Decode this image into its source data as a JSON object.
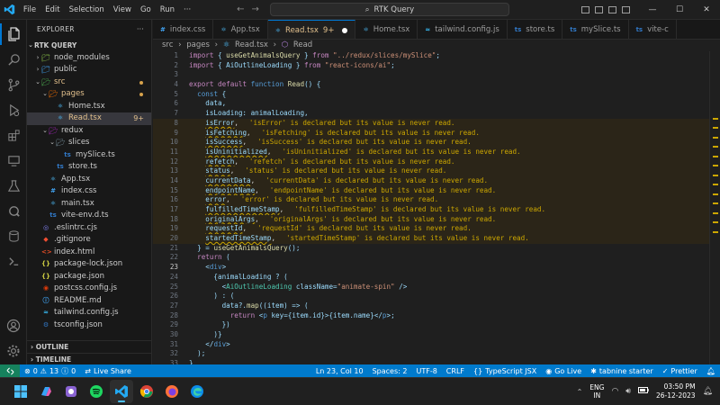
{
  "window": {
    "menu": [
      "File",
      "Edit",
      "Selection",
      "View",
      "Go",
      "Run",
      "···"
    ],
    "search_text": "RTK Query"
  },
  "activity_bar": [
    "files-icon",
    "search-icon",
    "source-control-icon",
    "run-debug-icon",
    "extensions-icon",
    "remote-explorer-icon",
    "testing-icon",
    "docker-icon",
    "database-icon",
    "terminal-icon",
    "accounts-icon",
    "manage-gear-icon"
  ],
  "explorer": {
    "header": "EXPLORER",
    "root": "RTK QUERY",
    "items": [
      {
        "label": "node_modules",
        "depth": 1,
        "type": "folder",
        "open": false,
        "color": "#cccccc"
      },
      {
        "label": "public",
        "depth": 1,
        "type": "folder",
        "open": false,
        "color": "#cccccc"
      },
      {
        "label": "src",
        "depth": 1,
        "type": "folder",
        "open": true,
        "color": "#e2c08d",
        "dot": true
      },
      {
        "label": "pages",
        "depth": 2,
        "type": "folder",
        "open": true,
        "color": "#e2c08d",
        "dot": true
      },
      {
        "label": "Home.tsx",
        "depth": 3,
        "type": "file",
        "icon": "react",
        "color": "#cccccc"
      },
      {
        "label": "Read.tsx",
        "depth": 3,
        "type": "file",
        "icon": "react",
        "color": "#e2c08d",
        "badge": "9+",
        "selected": true
      },
      {
        "label": "redux",
        "depth": 2,
        "type": "folder",
        "open": true,
        "color": "#cccccc"
      },
      {
        "label": "slices",
        "depth": 3,
        "type": "folder",
        "open": true,
        "color": "#cccccc"
      },
      {
        "label": "mySlice.ts",
        "depth": 4,
        "type": "file",
        "icon": "ts",
        "color": "#cccccc"
      },
      {
        "label": "store.ts",
        "depth": 3,
        "type": "file",
        "icon": "ts",
        "color": "#cccccc"
      },
      {
        "label": "App.tsx",
        "depth": 2,
        "type": "file",
        "icon": "react",
        "color": "#cccccc"
      },
      {
        "label": "index.css",
        "depth": 2,
        "type": "file",
        "icon": "css",
        "color": "#cccccc"
      },
      {
        "label": "main.tsx",
        "depth": 2,
        "type": "file",
        "icon": "react",
        "color": "#cccccc"
      },
      {
        "label": "vite-env.d.ts",
        "depth": 2,
        "type": "file",
        "icon": "ts",
        "color": "#cccccc"
      },
      {
        "label": ".eslintrc.cjs",
        "depth": 1,
        "type": "file",
        "icon": "eslint",
        "color": "#cccccc"
      },
      {
        "label": ".gitignore",
        "depth": 1,
        "type": "file",
        "icon": "git",
        "color": "#cccccc"
      },
      {
        "label": "index.html",
        "depth": 1,
        "type": "file",
        "icon": "html",
        "color": "#cccccc"
      },
      {
        "label": "package-lock.json",
        "depth": 1,
        "type": "file",
        "icon": "json",
        "color": "#cccccc"
      },
      {
        "label": "package.json",
        "depth": 1,
        "type": "file",
        "icon": "json",
        "color": "#cccccc"
      },
      {
        "label": "postcss.config.js",
        "depth": 1,
        "type": "file",
        "icon": "postcss",
        "color": "#cccccc"
      },
      {
        "label": "README.md",
        "depth": 1,
        "type": "file",
        "icon": "md",
        "color": "#cccccc"
      },
      {
        "label": "tailwind.config.js",
        "depth": 1,
        "type": "file",
        "icon": "tailwind",
        "color": "#cccccc"
      },
      {
        "label": "tsconfig.json",
        "depth": 1,
        "type": "file",
        "icon": "tsconfig",
        "color": "#cccccc"
      }
    ],
    "outline": "OUTLINE",
    "timeline": "TIMELINE"
  },
  "tabs": [
    {
      "label": "index.css",
      "icon": "css"
    },
    {
      "label": "App.tsx",
      "icon": "react"
    },
    {
      "label": "Read.tsx",
      "badge": "9+",
      "icon": "react",
      "active": true
    },
    {
      "label": "Home.tsx",
      "icon": "react"
    },
    {
      "label": "tailwind.config.js",
      "icon": "tailwind"
    },
    {
      "label": "store.ts",
      "icon": "ts"
    },
    {
      "label": "mySlice.ts",
      "icon": "ts"
    },
    {
      "label": "vite-c",
      "icon": "ts"
    }
  ],
  "breadcrumb": [
    "src",
    "pages",
    "Read.tsx",
    "Read"
  ],
  "editor": {
    "lines": [
      {
        "n": "1",
        "code": "import { useGetAnimalsQuery } from \"../redux/slices/mySlice\";"
      },
      {
        "n": "2",
        "code": "import { AiOutlineLoading } from \"react-icons/ai\";"
      },
      {
        "n": "3",
        "code": ""
      },
      {
        "n": "4",
        "code": "export default function Read() {"
      },
      {
        "n": "5",
        "code": "  const {"
      },
      {
        "n": "6",
        "code": "    data,"
      },
      {
        "n": "7",
        "code": "    isLoading: animalLoading,"
      },
      {
        "n": "8",
        "code": "    isError,",
        "diag": "'isError' is declared but its value is never read."
      },
      {
        "n": "9",
        "code": "    isFetching,",
        "diag": "'isFetching' is declared but its value is never read."
      },
      {
        "n": "10",
        "code": "    isSuccess,",
        "diag": "'isSuccess' is declared but its value is never read."
      },
      {
        "n": "11",
        "code": "    isUninitialized,",
        "diag": "'isUninitialized' is declared but its value is never read."
      },
      {
        "n": "12",
        "code": "    refetch,",
        "diag": "'refetch' is declared but its value is never read."
      },
      {
        "n": "13",
        "code": "    status,",
        "diag": "'status' is declared but its value is never read."
      },
      {
        "n": "14",
        "code": "    currentData,",
        "diag": "'currentData' is declared but its value is never read."
      },
      {
        "n": "15",
        "code": "    endpointName,",
        "diag": "'endpointName' is declared but its value is never read."
      },
      {
        "n": "16",
        "code": "    error,",
        "diag": "'error' is declared but its value is never read."
      },
      {
        "n": "17",
        "code": "    fulfilledTimeStamp,",
        "diag": "'fulfilledTimeStamp' is declared but its value is never read."
      },
      {
        "n": "18",
        "code": "    originalArgs,",
        "diag": "'originalArgs' is declared but its value is never read."
      },
      {
        "n": "19",
        "code": "    requestId,",
        "diag": "'requestId' is declared but its value is never read."
      },
      {
        "n": "20",
        "code": "    startedTimeStamp,",
        "diag": "'startedTimeStamp' is declared but its value is never read."
      },
      {
        "n": "21",
        "code": "  } = useGetAnimalsQuery();"
      },
      {
        "n": "22",
        "code": "  return ("
      },
      {
        "n": "23",
        "code": "    <div>"
      },
      {
        "n": "24",
        "code": "      {animalLoading ? ("
      },
      {
        "n": "25",
        "code": "        <AiOutlineLoading className=\"animate-spin\" />"
      },
      {
        "n": "26",
        "code": "      ) : ("
      },
      {
        "n": "27",
        "code": "        data?.map((item) => ("
      },
      {
        "n": "28",
        "code": "          return <p key={item.id}>{item.name}</p>;"
      },
      {
        "n": "29",
        "code": "        })"
      },
      {
        "n": "30",
        "code": "      )}"
      },
      {
        "n": "31",
        "code": "    </div>"
      },
      {
        "n": "32",
        "code": "  );"
      },
      {
        "n": "33",
        "code": "}"
      }
    ]
  },
  "status_bar": {
    "errors": "0",
    "warnings": "13",
    "info": "0",
    "live_share": "Live Share",
    "position": "Ln 23, Col 10",
    "spaces": "Spaces: 2",
    "encoding": "UTF-8",
    "eol": "CRLF",
    "language": "TypeScript JSX",
    "go_live": "Go Live",
    "tabnine": "tabnine starter",
    "prettier": "Prettier"
  },
  "taskbar": {
    "apps": [
      "windows-start-icon",
      "copilot-icon",
      "app-icon",
      "spotify-icon",
      "vscode-icon",
      "chrome-icon",
      "firefox-icon",
      "edge-icon"
    ],
    "lang_top": "ENG",
    "lang_bottom": "IN",
    "time": "03:50 PM",
    "date": "26-12-2023"
  },
  "colors": {
    "accent": "#007acc",
    "warning": "#cca700",
    "modified": "#e2c08d"
  }
}
